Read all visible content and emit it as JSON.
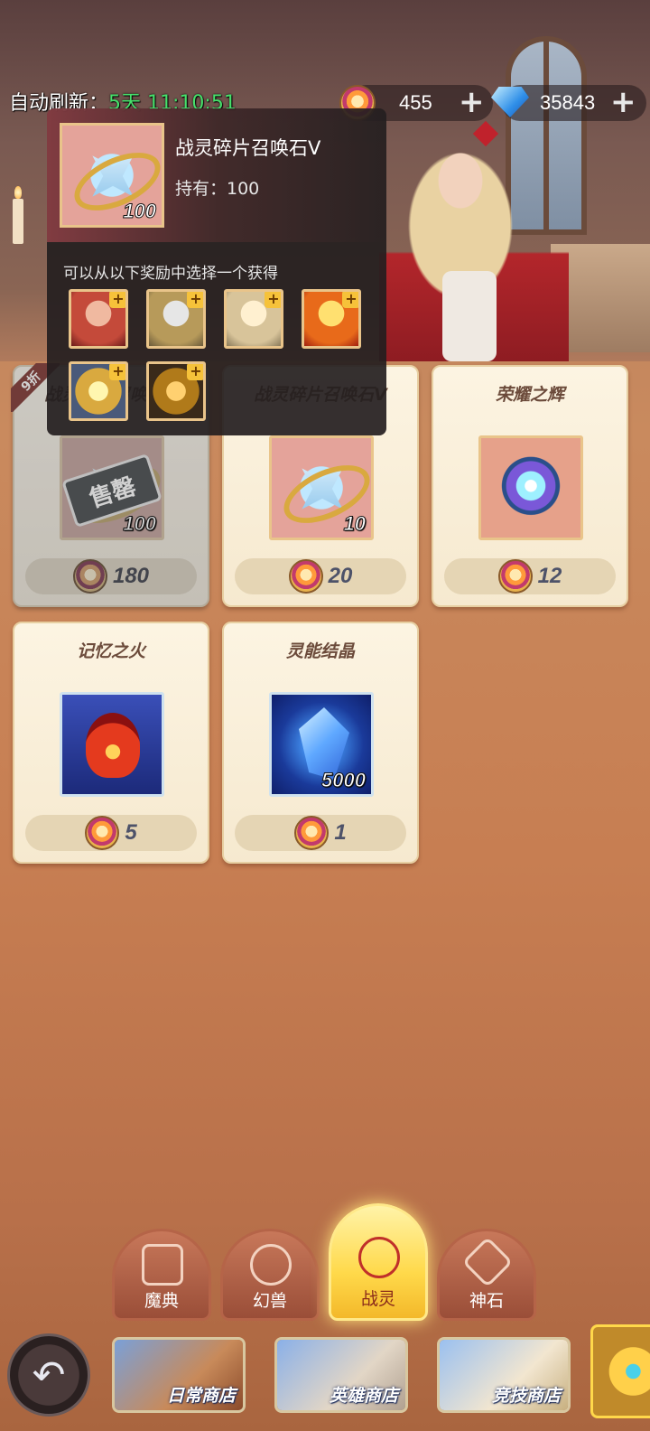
{
  "topbar": {
    "refresh_label": "自动刷新：",
    "refresh_countdown": "5天 11:10:51",
    "gold_value": "455",
    "gem_value": "35843",
    "plus": "+"
  },
  "tooltip": {
    "title": "战灵碎片召唤石V",
    "held": "持有：100",
    "icon_qty": "100",
    "description": "可以从以下奖励中选择一个获得",
    "reward_plus": "+"
  },
  "items": [
    {
      "name": "战灵碎片召唤石V",
      "qty": "100",
      "price": "180",
      "discount": "9折",
      "soldout": "售罄"
    },
    {
      "name": "战灵碎片召唤石V",
      "qty": "10",
      "price": "20"
    },
    {
      "name": "荣耀之辉",
      "qty": "",
      "price": "12"
    },
    {
      "name": "记忆之火",
      "qty": "",
      "price": "5"
    },
    {
      "name": "灵能结晶",
      "qty": "5000",
      "price": "1"
    }
  ],
  "categories": [
    {
      "label": "魔典"
    },
    {
      "label": "幻兽"
    },
    {
      "label": "战灵",
      "active": true
    },
    {
      "label": "神石"
    }
  ],
  "shops": [
    {
      "label": "日常商店"
    },
    {
      "label": "英雄商店"
    },
    {
      "label": "竞技商店"
    }
  ],
  "colors": {
    "countdown": "#47e06b",
    "active_tab": "#ffd94a",
    "discount": "#c8382e"
  },
  "icons": {
    "gold": "orb-coin-icon",
    "gem": "diamond-icon",
    "back": "back-arrow-icon"
  }
}
